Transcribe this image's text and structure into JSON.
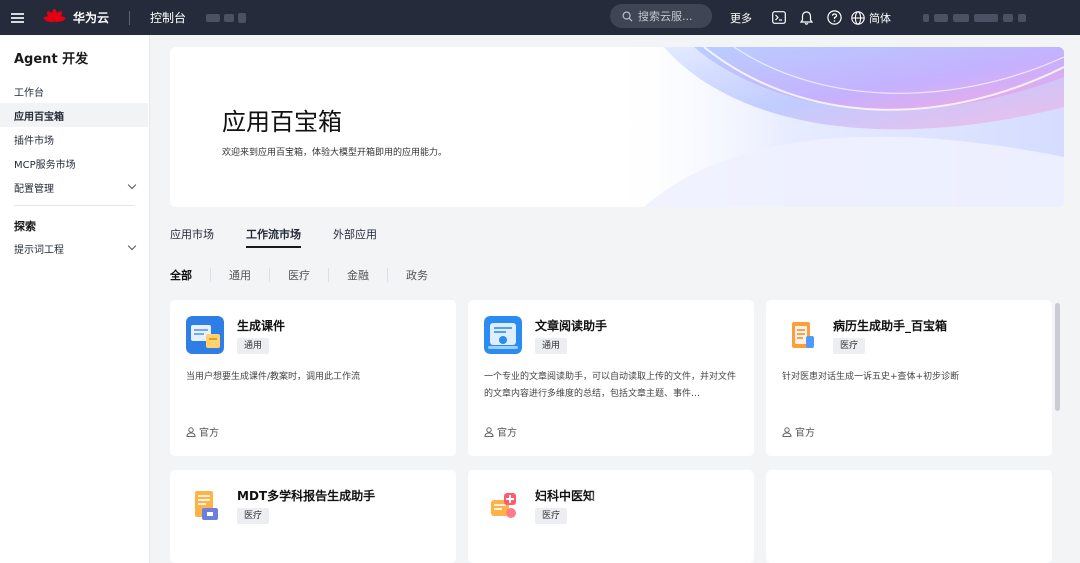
{
  "topbar": {
    "brand": "华为云",
    "console": "控制台",
    "search_placeholder": "搜索云服...",
    "more": "更多",
    "language": "简体"
  },
  "sidebar": {
    "title": "Agent 开发",
    "items": [
      {
        "label": "工作台"
      },
      {
        "label": "应用百宝箱"
      },
      {
        "label": "插件市场"
      },
      {
        "label": "MCP服务市场"
      },
      {
        "label": "配置管理"
      }
    ],
    "section2_title": "探索",
    "section2_items": [
      {
        "label": "提示词工程"
      }
    ]
  },
  "hero": {
    "title": "应用百宝箱",
    "subtitle": "欢迎来到应用百宝箱，体验大模型开箱即用的应用能力。"
  },
  "tabs": [
    {
      "label": "应用市场"
    },
    {
      "label": "工作流市场"
    },
    {
      "label": "外部应用"
    }
  ],
  "filters": [
    {
      "label": "全部"
    },
    {
      "label": "通用"
    },
    {
      "label": "医疗"
    },
    {
      "label": "金融"
    },
    {
      "label": "政务"
    }
  ],
  "cards": [
    {
      "title": "生成课件",
      "tag": "通用",
      "desc": "当用户想要生成课件/教案时，调用此工作流",
      "footer": "官方",
      "icon": "courseware-icon"
    },
    {
      "title": "文章阅读助手",
      "tag": "通用",
      "desc": "一个专业的文章阅读助手，可以自动读取上传的文件，并对文件的文章内容进行多维度的总结，包括文章主题、事件…",
      "footer": "官方",
      "icon": "article-reader-icon"
    },
    {
      "title": "病历生成助手_百宝箱",
      "tag": "医疗",
      "desc": "针对医患对话生成一诉五史+查体+初步诊断",
      "footer": "官方",
      "icon": "medical-record-icon"
    },
    {
      "title": "MDT多学科报告生成助手",
      "tag": "医疗",
      "icon": "mdt-report-icon"
    },
    {
      "title": "妇科中医知",
      "tag": "医疗",
      "icon": "gynecology-tcm-icon"
    }
  ]
}
